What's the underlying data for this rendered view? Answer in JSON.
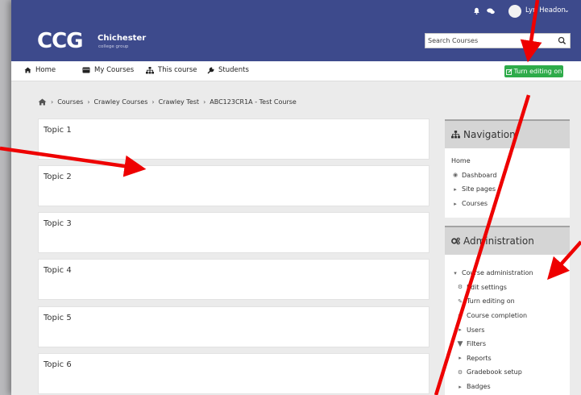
{
  "user": {
    "name": "Lyn Headon"
  },
  "brand": {
    "logo_text": "CCG",
    "name": "Chichester",
    "sub": "college group"
  },
  "search": {
    "placeholder": "Search Courses"
  },
  "nav": {
    "items": [
      "Home",
      "My Courses",
      "This course",
      "Students"
    ],
    "edit_button": "Turn editing on"
  },
  "breadcrumb": [
    "Courses",
    "Crawley Courses",
    "Crawley Test",
    "ABC123CR1A - Test Course"
  ],
  "topics": [
    "Topic 1",
    "Topic 2",
    "Topic 3",
    "Topic 4",
    "Topic 5",
    "Topic 6"
  ],
  "navigation_block": {
    "title": "Navigation",
    "items": [
      "Home",
      "Dashboard",
      "Site pages",
      "Courses"
    ]
  },
  "admin_block": {
    "title": "Administration",
    "items": [
      "Course administration",
      "Edit settings",
      "Turn editing on",
      "Course completion",
      "Users",
      "Filters",
      "Reports",
      "Gradebook setup",
      "Badges"
    ]
  },
  "colors": {
    "brand": "#3d4a8c",
    "edit_button": "#2eab4a",
    "annotation": "#ee0000"
  }
}
